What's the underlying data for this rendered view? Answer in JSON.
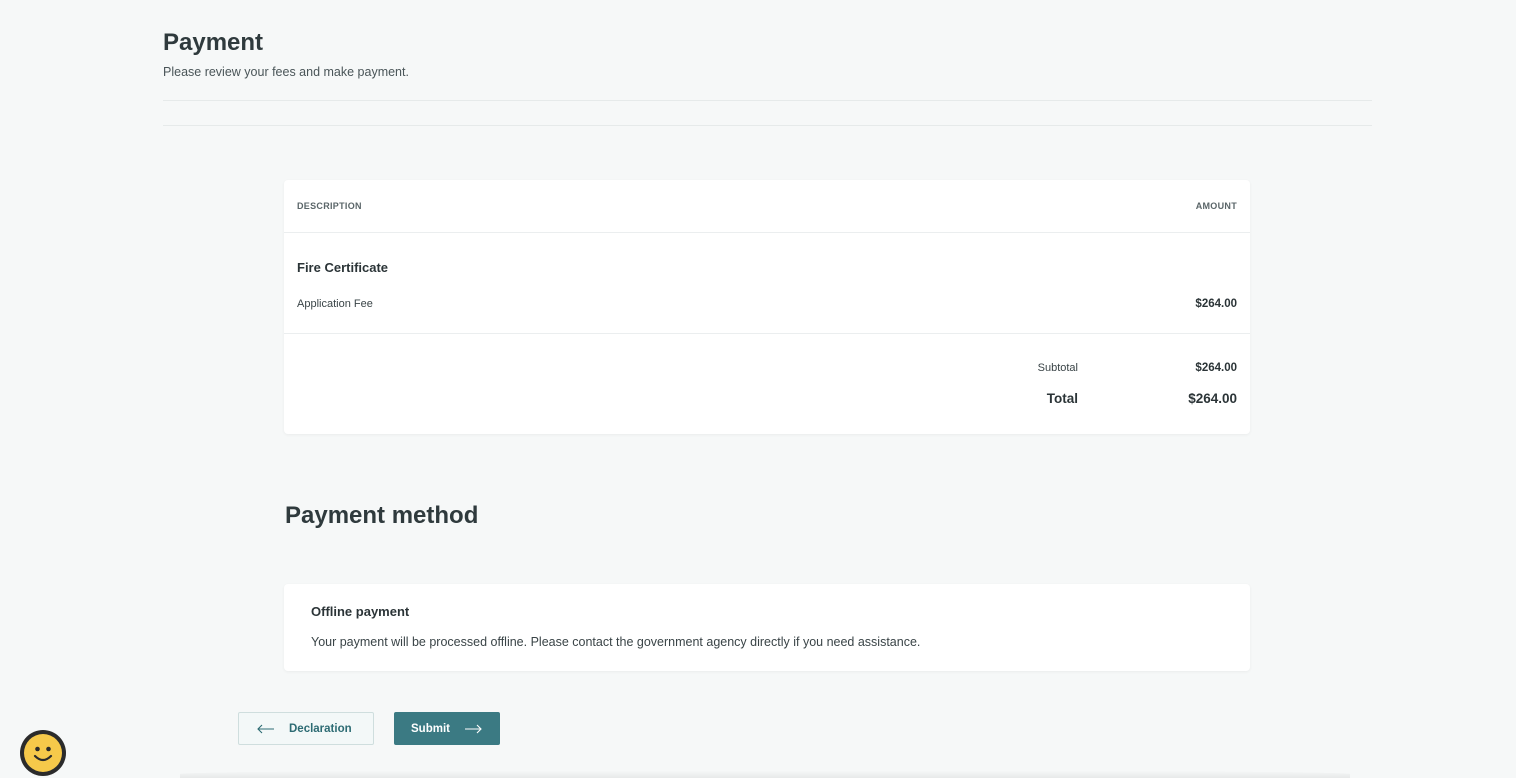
{
  "header": {
    "title": "Payment",
    "subtitle": "Please review your fees and make payment."
  },
  "fees": {
    "columns": {
      "description": "DESCRIPTION",
      "amount": "AMOUNT"
    },
    "item": {
      "title": "Fire Certificate",
      "name": "Application Fee",
      "amount": "$264.00"
    },
    "subtotal": {
      "label": "Subtotal",
      "amount": "$264.00"
    },
    "total": {
      "label": "Total",
      "amount": "$264.00"
    }
  },
  "payment_method": {
    "title": "Payment method",
    "option": {
      "title": "Offline payment",
      "description": "Your payment will be processed offline. Please contact the government agency directly if you need assistance."
    }
  },
  "buttons": {
    "back_label": "Declaration",
    "submit_label": "Submit"
  },
  "icons": {
    "back": "arrow-left-icon",
    "submit": "arrow-right-icon",
    "chat": "smiley-face-icon"
  },
  "colors": {
    "accent": "#3b7a83",
    "background": "#f6f8f8",
    "chat_face": "#f6c94a"
  }
}
